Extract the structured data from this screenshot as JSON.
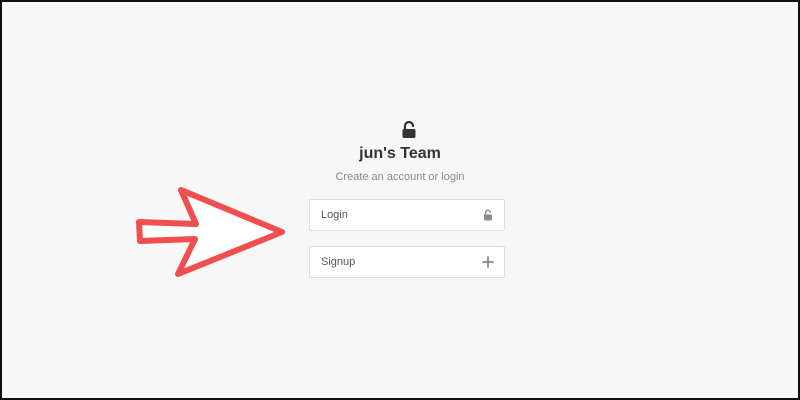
{
  "header": {
    "icon": "unlocked-padlock-icon",
    "title": "jun's Team",
    "subtitle": "Create an account or login"
  },
  "actions": {
    "login_label": "Login",
    "login_icon": "lock-icon",
    "signup_label": "Signup",
    "signup_icon": "plus-icon"
  },
  "annotation": {
    "icon": "arrow-right-icon",
    "color": "#ef4f4f"
  },
  "colors": {
    "background": "#f7f7f7",
    "text": "#333333",
    "muted": "#8a8a8a"
  }
}
